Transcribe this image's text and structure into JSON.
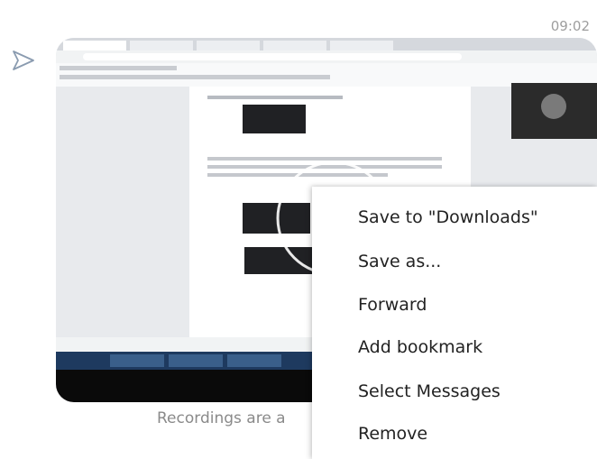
{
  "message": {
    "time": "09:02",
    "caption": "Recordings are a"
  },
  "icons": {
    "send": "send-arrow-icon"
  },
  "context_menu": {
    "items": [
      {
        "label": "Save to \"Downloads\""
      },
      {
        "label": "Save as..."
      },
      {
        "label": "Forward"
      },
      {
        "label": "Add bookmark"
      },
      {
        "label": "Select Messages"
      },
      {
        "label": "Remove"
      }
    ]
  }
}
